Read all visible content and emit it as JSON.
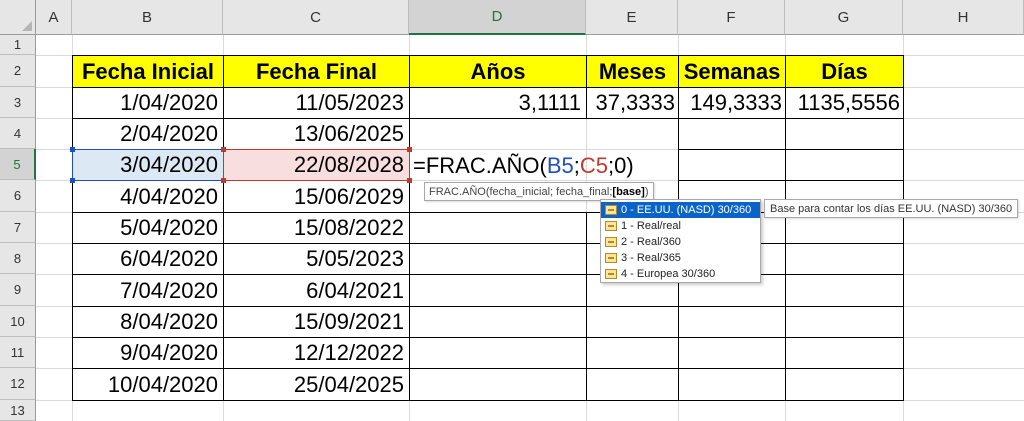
{
  "columns": [
    "A",
    "B",
    "C",
    "D",
    "E",
    "F",
    "G",
    "H"
  ],
  "active_column": "D",
  "rows": [
    "1",
    "2",
    "3",
    "4",
    "5",
    "6",
    "7",
    "8",
    "9",
    "10",
    "11",
    "12",
    "13"
  ],
  "active_row": "5",
  "headers": {
    "fecha_inicial": "Fecha Inicial",
    "fecha_final": "Fecha Final",
    "anos": "Años",
    "meses": "Meses",
    "semanas": "Semanas",
    "dias": "Días"
  },
  "data_rows": [
    {
      "inicial": "1/04/2020",
      "final": "11/05/2023",
      "anos": "3,1111",
      "meses": "37,3333",
      "semanas": "149,3333",
      "dias": "1135,5556"
    },
    {
      "inicial": "2/04/2020",
      "final": "13/06/2025"
    },
    {
      "inicial": "3/04/2020",
      "final": "22/08/2028"
    },
    {
      "inicial": "4/04/2020",
      "final": "15/06/2029"
    },
    {
      "inicial": "5/04/2020",
      "final": "15/08/2022"
    },
    {
      "inicial": "6/04/2020",
      "final": "5/05/2023"
    },
    {
      "inicial": "7/04/2020",
      "final": "6/04/2021"
    },
    {
      "inicial": "8/04/2020",
      "final": "15/09/2021"
    },
    {
      "inicial": "9/04/2020",
      "final": "12/12/2022"
    },
    {
      "inicial": "10/04/2020",
      "final": "25/04/2025"
    }
  ],
  "formula": {
    "prefix": "=FRAC.AÑO(",
    "ref1": "B5",
    "sep1": ";",
    "ref2": "C5",
    "sep2": ";",
    "tail": "0)"
  },
  "tooltip": {
    "prefix": "FRAC.AÑO(fecha_inicial; fecha_final; ",
    "bold": "[base]",
    "suffix": ")"
  },
  "dropdown_items": [
    "0 - EE.UU. (NASD) 30/360",
    "1 - Real/real",
    "2 - Real/360",
    "3 - Real/365",
    "4 - Europea 30/360"
  ],
  "side_tooltip": "Base para contar los días EE.UU. (NASD) 30/360",
  "colors": {
    "header_fill": "#ffff00",
    "selection_b5": "#dde8f5",
    "selection_c5": "#f8dede",
    "ref_blue": "#1f4fbf",
    "ref_red": "#c0392b",
    "dropdown_selected": "#0a64c8"
  }
}
